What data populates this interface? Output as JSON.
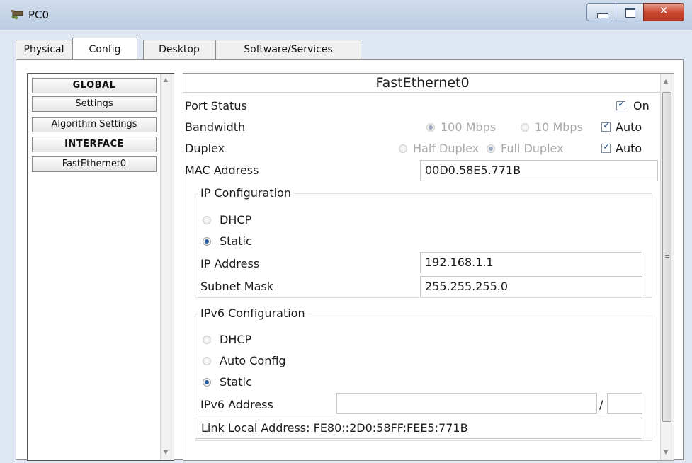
{
  "window": {
    "title": "PC0",
    "close_glyph": "✕"
  },
  "tabs": [
    {
      "label": "Physical",
      "active": false
    },
    {
      "label": "Config",
      "active": true
    },
    {
      "label": "Desktop",
      "active": false
    },
    {
      "label": "Software/Services",
      "active": false
    }
  ],
  "left_list": {
    "items": [
      "GLOBAL",
      "Settings",
      "Algorithm Settings",
      "INTERFACE",
      "FastEthernet0"
    ]
  },
  "interface": {
    "title": "FastEthernet0",
    "port_status": {
      "label": "Port Status",
      "on_label": "On",
      "on": true
    },
    "bandwidth": {
      "label": "Bandwidth",
      "opt_100": "100 Mbps",
      "opt_10": "10 Mbps",
      "auto_label": "Auto",
      "selected": "100 Mbps",
      "auto": true
    },
    "duplex": {
      "label": "Duplex",
      "opt_half": "Half Duplex",
      "opt_full": "Full Duplex",
      "auto_label": "Auto",
      "selected": "Full Duplex",
      "auto": true
    },
    "mac": {
      "label": "MAC Address",
      "value": "00D0.58E5.771B"
    }
  },
  "ip_config": {
    "title": "IP Configuration",
    "dhcp_label": "DHCP",
    "static_label": "Static",
    "mode": "Static",
    "ip_label": "IP Address",
    "ip_value": "192.168.1.1",
    "mask_label": "Subnet Mask",
    "mask_value": "255.255.255.0"
  },
  "ipv6_config": {
    "title": "IPv6 Configuration",
    "dhcp_label": "DHCP",
    "auto_label": "Auto Config",
    "static_label": "Static",
    "mode": "Static",
    "addr_label": "IPv6 Address",
    "addr_value": "",
    "slash": "/",
    "prefix_value": "",
    "link_local_label": "Link Local Address:",
    "link_local_value": "FE80::2D0:58FF:FEE5:771B"
  },
  "colors": {
    "title_bar": "#bccde3",
    "close_button": "#c8452f",
    "radio_selected": "#2c5f9b"
  },
  "icons": [
    "app-icon",
    "minimize-icon",
    "maximize-icon",
    "close-icon",
    "scroll-up-icon",
    "scroll-down-icon"
  ]
}
